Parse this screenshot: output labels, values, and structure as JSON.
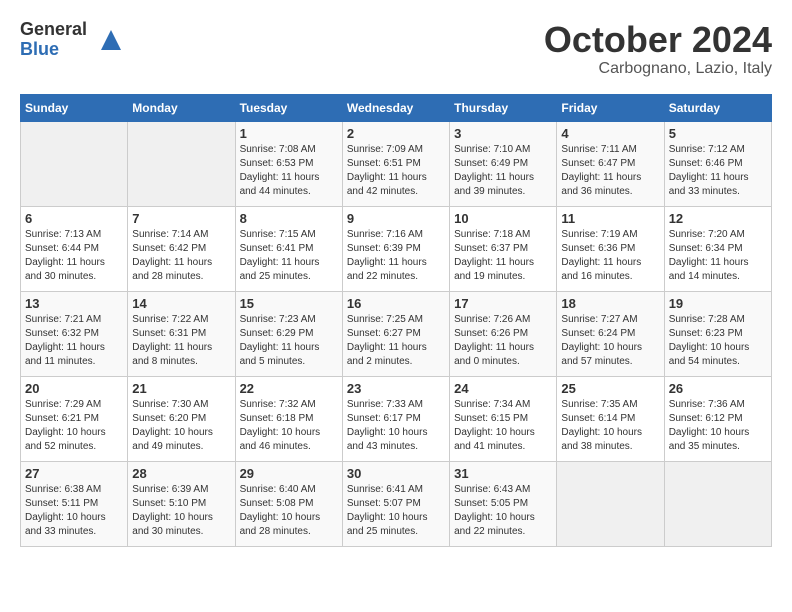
{
  "logo": {
    "general": "General",
    "blue": "Blue"
  },
  "title": "October 2024",
  "location": "Carbognano, Lazio, Italy",
  "days_header": [
    "Sunday",
    "Monday",
    "Tuesday",
    "Wednesday",
    "Thursday",
    "Friday",
    "Saturday"
  ],
  "weeks": [
    [
      {
        "day": "",
        "info": ""
      },
      {
        "day": "",
        "info": ""
      },
      {
        "day": "1",
        "info": "Sunrise: 7:08 AM\nSunset: 6:53 PM\nDaylight: 11 hours and 44 minutes."
      },
      {
        "day": "2",
        "info": "Sunrise: 7:09 AM\nSunset: 6:51 PM\nDaylight: 11 hours and 42 minutes."
      },
      {
        "day": "3",
        "info": "Sunrise: 7:10 AM\nSunset: 6:49 PM\nDaylight: 11 hours and 39 minutes."
      },
      {
        "day": "4",
        "info": "Sunrise: 7:11 AM\nSunset: 6:47 PM\nDaylight: 11 hours and 36 minutes."
      },
      {
        "day": "5",
        "info": "Sunrise: 7:12 AM\nSunset: 6:46 PM\nDaylight: 11 hours and 33 minutes."
      }
    ],
    [
      {
        "day": "6",
        "info": "Sunrise: 7:13 AM\nSunset: 6:44 PM\nDaylight: 11 hours and 30 minutes."
      },
      {
        "day": "7",
        "info": "Sunrise: 7:14 AM\nSunset: 6:42 PM\nDaylight: 11 hours and 28 minutes."
      },
      {
        "day": "8",
        "info": "Sunrise: 7:15 AM\nSunset: 6:41 PM\nDaylight: 11 hours and 25 minutes."
      },
      {
        "day": "9",
        "info": "Sunrise: 7:16 AM\nSunset: 6:39 PM\nDaylight: 11 hours and 22 minutes."
      },
      {
        "day": "10",
        "info": "Sunrise: 7:18 AM\nSunset: 6:37 PM\nDaylight: 11 hours and 19 minutes."
      },
      {
        "day": "11",
        "info": "Sunrise: 7:19 AM\nSunset: 6:36 PM\nDaylight: 11 hours and 16 minutes."
      },
      {
        "day": "12",
        "info": "Sunrise: 7:20 AM\nSunset: 6:34 PM\nDaylight: 11 hours and 14 minutes."
      }
    ],
    [
      {
        "day": "13",
        "info": "Sunrise: 7:21 AM\nSunset: 6:32 PM\nDaylight: 11 hours and 11 minutes."
      },
      {
        "day": "14",
        "info": "Sunrise: 7:22 AM\nSunset: 6:31 PM\nDaylight: 11 hours and 8 minutes."
      },
      {
        "day": "15",
        "info": "Sunrise: 7:23 AM\nSunset: 6:29 PM\nDaylight: 11 hours and 5 minutes."
      },
      {
        "day": "16",
        "info": "Sunrise: 7:25 AM\nSunset: 6:27 PM\nDaylight: 11 hours and 2 minutes."
      },
      {
        "day": "17",
        "info": "Sunrise: 7:26 AM\nSunset: 6:26 PM\nDaylight: 11 hours and 0 minutes."
      },
      {
        "day": "18",
        "info": "Sunrise: 7:27 AM\nSunset: 6:24 PM\nDaylight: 10 hours and 57 minutes."
      },
      {
        "day": "19",
        "info": "Sunrise: 7:28 AM\nSunset: 6:23 PM\nDaylight: 10 hours and 54 minutes."
      }
    ],
    [
      {
        "day": "20",
        "info": "Sunrise: 7:29 AM\nSunset: 6:21 PM\nDaylight: 10 hours and 52 minutes."
      },
      {
        "day": "21",
        "info": "Sunrise: 7:30 AM\nSunset: 6:20 PM\nDaylight: 10 hours and 49 minutes."
      },
      {
        "day": "22",
        "info": "Sunrise: 7:32 AM\nSunset: 6:18 PM\nDaylight: 10 hours and 46 minutes."
      },
      {
        "day": "23",
        "info": "Sunrise: 7:33 AM\nSunset: 6:17 PM\nDaylight: 10 hours and 43 minutes."
      },
      {
        "day": "24",
        "info": "Sunrise: 7:34 AM\nSunset: 6:15 PM\nDaylight: 10 hours and 41 minutes."
      },
      {
        "day": "25",
        "info": "Sunrise: 7:35 AM\nSunset: 6:14 PM\nDaylight: 10 hours and 38 minutes."
      },
      {
        "day": "26",
        "info": "Sunrise: 7:36 AM\nSunset: 6:12 PM\nDaylight: 10 hours and 35 minutes."
      }
    ],
    [
      {
        "day": "27",
        "info": "Sunrise: 6:38 AM\nSunset: 5:11 PM\nDaylight: 10 hours and 33 minutes."
      },
      {
        "day": "28",
        "info": "Sunrise: 6:39 AM\nSunset: 5:10 PM\nDaylight: 10 hours and 30 minutes."
      },
      {
        "day": "29",
        "info": "Sunrise: 6:40 AM\nSunset: 5:08 PM\nDaylight: 10 hours and 28 minutes."
      },
      {
        "day": "30",
        "info": "Sunrise: 6:41 AM\nSunset: 5:07 PM\nDaylight: 10 hours and 25 minutes."
      },
      {
        "day": "31",
        "info": "Sunrise: 6:43 AM\nSunset: 5:05 PM\nDaylight: 10 hours and 22 minutes."
      },
      {
        "day": "",
        "info": ""
      },
      {
        "day": "",
        "info": ""
      }
    ]
  ]
}
